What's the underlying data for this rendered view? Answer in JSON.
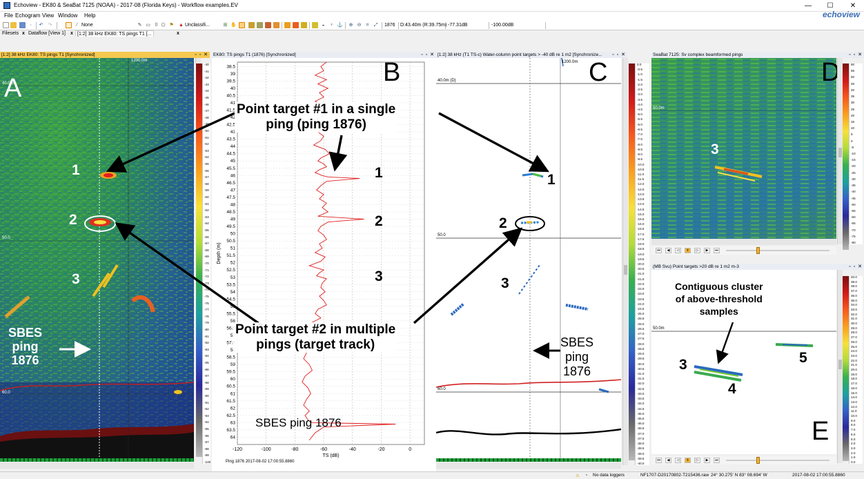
{
  "window": {
    "title": "Echoview - EK80 & SeaBat 7125 (NOAA) - 2017-08 (Florida Keys) - Workflow examples.EV",
    "minimize": "—",
    "maximize": "☐",
    "close": "✕"
  },
  "menu": {
    "items": [
      "File",
      "Echogram",
      "View",
      "Window",
      "Help"
    ],
    "logo": "echoview"
  },
  "toolbar": {
    "line_style": "None",
    "region_class": "Unclassifi...",
    "ping": "1876",
    "depth_range": "D:43.40m (R:39.75m)",
    "value_sv": "-77.31dB",
    "value_min": "-100.00dB"
  },
  "tabs": {
    "filesets": "Filesets",
    "dataflow": "Dataflow [View 1]",
    "echogram": "[1:2] 38 kHz EK80: TS pings T1 [...",
    "close": "x"
  },
  "panels": {
    "a": {
      "title": "[1:2] 38 kHz EK80: TS pings T1 [Synchronized]",
      "controls": "▫ ▫ ✕",
      "letter": "A",
      "range_label": "1200.0m",
      "depth_40": "40.0m",
      "depth_50": "50.0",
      "depth_60": "60.0"
    },
    "b": {
      "title": "EK80: TS pings T1 (1876) [Synchronized]",
      "controls": "▫ ▫ ✕",
      "letter": "B",
      "status": "Ping 1876 2017-08-02 17:00:55.8860"
    },
    "c": {
      "title": "[1:2] 38 kHz (T1 TS-c) Water-column point targets > -40 dB re 1 m2 [Synchronize...",
      "controls": "▫ ▫ ✕",
      "letter": "C",
      "range_label": "1200.0m",
      "depth_40": "40.0m (D)",
      "depth_50": "50.0",
      "depth_60": "60.0"
    },
    "d": {
      "title": "SeaBat 7125: Sv complex beamformed pings",
      "controls": "▫ ▫ ✕",
      "letter": "D",
      "depth_50": "50.0m"
    },
    "e": {
      "title": "(MB Svu) Point targets >20 dB re 1 m2 m-3",
      "controls": "▫ ▫ ✕",
      "letter": "E",
      "depth_50": "50.0m"
    }
  },
  "annotations": {
    "pt1_line1": "Point target #1 in a single",
    "pt1_line2": "ping (ping 1876)",
    "pt2_line1": "Point target #2 in multiple",
    "pt2_line2": "pings (target track)",
    "sbes_a": [
      "SBES",
      "ping",
      "1876"
    ],
    "sbes_c": [
      "SBES",
      "ping",
      "1876"
    ],
    "sbes_b": "SBES ping 1876",
    "cluster": [
      "Contiguous cluster",
      "of above-threshold",
      "samples"
    ],
    "n1": "1",
    "n2": "2",
    "n3": "3",
    "n4": "4",
    "n5": "5"
  },
  "scales": {
    "a": [
      "-40",
      "-41",
      "-42",
      "-43",
      "-44",
      "-45",
      "-46",
      "-47",
      "-48",
      "-49",
      "-50",
      "-51",
      "-52",
      "-53",
      "-54",
      "-55",
      "-56",
      "-57",
      "-58",
      "-59",
      "-60",
      "-61",
      "-62",
      "-63",
      "-64",
      "-65",
      "-66",
      "-67",
      "-68",
      "-69",
      "-70",
      "-71",
      "-72",
      "-73",
      "-74",
      "-75",
      "-76",
      "-77",
      "-78",
      "-79",
      "-80",
      "-81",
      "-82",
      "-83",
      "-84",
      "-85",
      "-86",
      "-87",
      "-88",
      "-89",
      "-90",
      "-91",
      "-92",
      "-93",
      "-94",
      "-95",
      "-96",
      "-97",
      "-98",
      "-99",
      "-100"
    ],
    "c": [
      "0.0",
      "-0.5",
      "-1.0",
      "-1.5",
      "-2.0",
      "-2.5",
      "-3.0",
      "-3.5",
      "-4.0",
      "-4.5",
      "-5.0",
      "-5.5",
      "-6.0",
      "-6.5",
      "-7.0",
      "-7.5",
      "-8.0",
      "-8.5",
      "-9.0",
      "-9.5",
      "-10.0",
      "-10.5",
      "-11.0",
      "-11.5",
      "-12.0",
      "-12.5",
      "-13.0",
      "-13.5",
      "-14.0",
      "-14.5",
      "-15.0",
      "-15.5",
      "-16.0",
      "-16.5",
      "-17.0",
      "-17.5",
      "-18.0",
      "-18.5",
      "-19.0",
      "-19.5",
      "-20.0",
      "-20.5",
      "-21.0",
      "-21.5",
      "-22.0",
      "-22.5",
      "-23.0",
      "-23.5",
      "-24.0",
      "-24.5",
      "-25.0",
      "-25.5",
      "-26.0",
      "-26.5",
      "-27.0",
      "-27.5",
      "-28.0",
      "-28.5",
      "-29.0",
      "-29.5",
      "-30.0",
      "-30.5",
      "-31.0",
      "-31.5",
      "-32.0",
      "-32.5",
      "-33.0",
      "-33.5",
      "-34.0",
      "-34.5",
      "-35.0",
      "-35.5",
      "-36.0",
      "-36.5",
      "-37.0",
      "-37.5",
      "-38.0",
      "-38.5",
      "-39.0",
      "-39.5",
      "-40.0"
    ],
    "d": [
      "60",
      "55",
      "50",
      "45",
      "40",
      "35",
      "30",
      "25",
      "20",
      "15",
      "10",
      "5",
      "0",
      "-5",
      "-10",
      "-15",
      "-20",
      "-25",
      "-30",
      "-35",
      "-40",
      "-45",
      "-50",
      "-55",
      "-60",
      "-65",
      "-70",
      "-75",
      "-80"
    ],
    "e": [
      "40.0",
      "39.0",
      "38.0",
      "37.0",
      "36.0",
      "35.0",
      "34.0",
      "33.0",
      "32.0",
      "31.0",
      "30.0",
      "29.0",
      "28.0",
      "27.0",
      "26.0",
      "25.0",
      "24.0",
      "23.0",
      "22.0",
      "21.0",
      "20.0",
      "19.0",
      "18.0",
      "17.0",
      "16.0",
      "15.0",
      "14.0",
      "13.0",
      "12.0",
      "11.0",
      "10.0",
      "9.0",
      "8.0",
      "7.0",
      "6.0",
      "5.0",
      "4.0",
      "3.0",
      "2.0",
      "1.0",
      "0.0"
    ]
  },
  "statusbar": {
    "warning": "No data loggers",
    "file": "NF1707-D20170802-T215436.raw",
    "position": "24° 30.275' N 83° 08.694' W",
    "time": "2017-08-02 17:00:55.8860"
  },
  "colors": {
    "active_title": "#f5c850",
    "panel_title": "#e9edf3",
    "ts_line": "#e02020",
    "sbes_line": "#cc2020"
  },
  "chart_data": {
    "type": "line",
    "xlabel": "TS (dB)",
    "ylabel": "Depth (m)",
    "xlim": [
      -120,
      10
    ],
    "ylim": [
      38.2,
      64.5
    ],
    "x_ticks": [
      -120,
      -100,
      -80,
      -60,
      -40,
      -20,
      0
    ],
    "y_ticks": [
      38.5,
      39,
      39.5,
      40,
      40.5,
      41,
      41.5,
      42,
      42.5,
      43,
      43.5,
      44,
      44.5,
      45,
      45.5,
      46,
      46.5,
      47,
      47.5,
      48,
      48.5,
      49,
      49.5,
      50,
      50.5,
      51,
      51.5,
      52,
      52.5,
      53,
      53.5,
      54,
      54.5,
      55,
      55.5,
      56,
      56.5,
      57,
      57.5,
      58,
      58.5,
      59,
      59.5,
      60,
      60.5,
      61,
      61.5,
      62,
      62.5,
      63,
      63.5,
      64
    ],
    "grid": true,
    "series": [
      {
        "values_x": [
          -58,
          -62,
          -60,
          -66,
          -58,
          -64,
          -57,
          -63,
          -60,
          -66,
          -59,
          -63,
          -58,
          -65,
          -61,
          -57,
          -64,
          -60,
          -62,
          -67,
          -59,
          -56,
          -62,
          -64,
          -60,
          -58,
          -63,
          -66,
          -61,
          -57,
          -35,
          -58,
          -62,
          -65,
          -60,
          -63,
          -58,
          -61,
          -57,
          -64,
          -32,
          -57,
          -62,
          -64,
          -60,
          -58,
          -63,
          -61,
          -66,
          -59,
          -62,
          -70,
          -60,
          -63,
          -65,
          -58,
          -61,
          -62,
          -59,
          -63,
          -60,
          -58,
          -64,
          -66,
          -62,
          -70,
          -75,
          -71,
          -69,
          -73,
          -72,
          -74,
          -70,
          -68,
          -73,
          -75,
          -71,
          -69,
          -72,
          -74,
          -70,
          -73,
          -71,
          -68,
          -10,
          -60,
          -66,
          -70
        ],
        "values_y": [
          38.2,
          38.5,
          38.8,
          39.1,
          39.4,
          39.7,
          40.0,
          40.3,
          40.6,
          40.9,
          41.2,
          41.5,
          41.8,
          42.1,
          42.4,
          42.7,
          43.0,
          43.3,
          43.6,
          43.9,
          44.2,
          44.5,
          44.8,
          45.0,
          45.2,
          45.4,
          45.6,
          45.8,
          46.0,
          46.1,
          46.2,
          46.4,
          46.7,
          47.0,
          47.3,
          47.6,
          47.9,
          48.2,
          48.5,
          48.8,
          49.0,
          49.2,
          49.5,
          49.8,
          50.1,
          50.4,
          50.7,
          51.0,
          51.3,
          51.6,
          51.9,
          52.2,
          52.5,
          52.7,
          52.9,
          53.1,
          53.4,
          53.7,
          54.0,
          54.3,
          54.6,
          54.9,
          55.2,
          55.5,
          55.8,
          56.2,
          56.6,
          57.0,
          57.4,
          57.8,
          58.2,
          58.6,
          59.0,
          59.4,
          59.8,
          60.2,
          60.6,
          61.0,
          61.4,
          61.8,
          62.2,
          62.5,
          62.8,
          63.0,
          63.1,
          63.3,
          63.7,
          64.2
        ]
      }
    ]
  }
}
